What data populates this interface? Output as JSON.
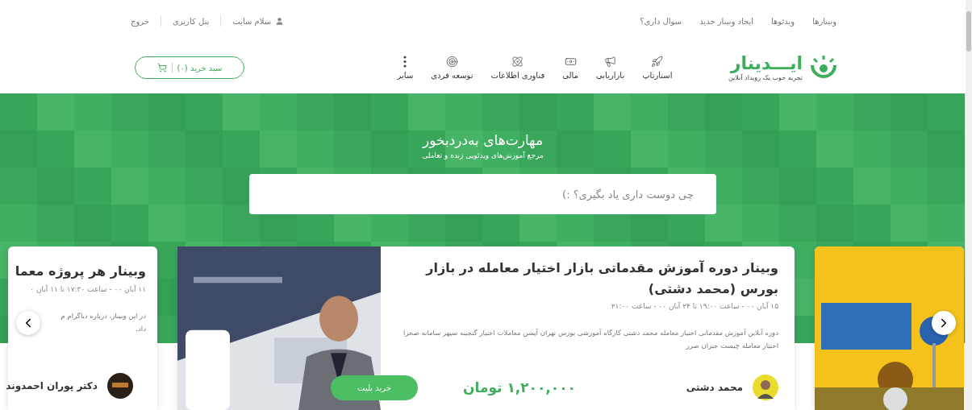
{
  "top_bar": {
    "links": [
      "وبینارها",
      "ویدئوها",
      "ایجاد وبینار جدید",
      "سوال داری؟"
    ],
    "user": {
      "greeting": "سلام سایت",
      "panel": "پنل کاربری",
      "logout": "خروج"
    }
  },
  "nav": {
    "logo": {
      "name": "ایـــدینار",
      "tagline": "تجربه خوب یک رویداد آنلاین"
    },
    "categories": [
      "استارتاپ",
      "بازاریابی",
      "مالی",
      "فناوری اطلاعات",
      "توسعه فردی",
      "سایر"
    ],
    "cart": {
      "label": "سبد خرید (۰)"
    }
  },
  "hero": {
    "title": "مهارت‌های به‌دردبخور",
    "subtitle": "مرجع آموزش‌های ویدئویی زنده و تعاملی",
    "search": {
      "placeholder": "چی دوست داری یاد بگیری؟ :)"
    }
  },
  "carousel": {
    "cards": [
      {
        "kind": "poster"
      },
      {
        "kind": "featured",
        "title": "وبینار دوره آموزش مقدماتی بازار اختیار معامله در بازار بورس (محمد دشتی)",
        "date": "۱۵ آبان ۰۰ - ساعت ۱۹:۰۰ تا ۲۴ آبان ۰۰ - ساعت ۲۱:۰۰",
        "description": "دوره آنلاین آموزش مقدماتی اختیار معامله محمد دشتی کارگاه آموزشی بورس تهران آپشن معاملات اختیار گنجینه سپهر سامانه صحرا اختیار معامله چیست جبران ضرر",
        "host": "محمد دشتی",
        "price": "۱,۲۰۰,۰۰۰ تومان",
        "buy_label": "خرید بلیت"
      },
      {
        "kind": "partial",
        "title": "وبینار هر پروژه معما",
        "date": "۱۱ آبان ۰۰ - ساعت ۱۷:۳۰ تا ۱۱ آبان ۰",
        "description_lines": [
          "در این وبینار، درباره دیاگرام م",
          "داد."
        ],
        "host": "دکتر پوران احمدوند"
      }
    ]
  }
}
